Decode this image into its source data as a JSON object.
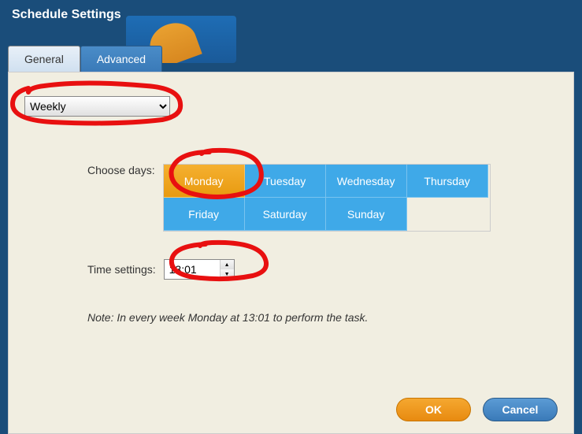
{
  "window": {
    "title": "Schedule Settings"
  },
  "tabs": {
    "general": "General",
    "advanced": "Advanced"
  },
  "frequency": {
    "selected": "Weekly"
  },
  "labels": {
    "choose_days": "Choose days:",
    "time_settings": "Time settings:"
  },
  "days": [
    {
      "label": "Monday",
      "selected": true
    },
    {
      "label": "Tuesday",
      "selected": false
    },
    {
      "label": "Wednesday",
      "selected": false
    },
    {
      "label": "Thursday",
      "selected": false
    },
    {
      "label": "Friday",
      "selected": false
    },
    {
      "label": "Saturday",
      "selected": false
    },
    {
      "label": "Sunday",
      "selected": false
    }
  ],
  "time": {
    "value": "13:01"
  },
  "note": "Note: In every week Monday at 13:01 to perform the task.",
  "buttons": {
    "ok": "OK",
    "cancel": "Cancel"
  },
  "annotations": {
    "color": "#e81010"
  }
}
